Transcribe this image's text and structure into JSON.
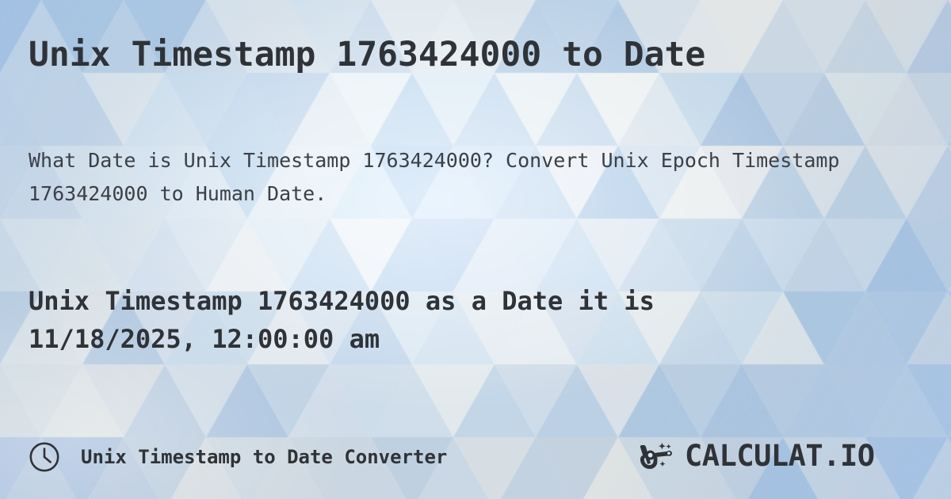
{
  "page": {
    "title": "Unix Timestamp 1763424000 to Date",
    "description": "What Date is Unix Timestamp 1763424000? Convert Unix Epoch Timestamp 1763424000 to Human Date.",
    "result": "Unix Timestamp 1763424000 as a Date it is 11/18/2025, 12:00:00 am",
    "timestamp": "1763424000",
    "converted_date": "11/18/2025, 12:00:00 am"
  },
  "footer": {
    "label": "Unix Timestamp to Date Converter",
    "clock_icon": "clock-icon",
    "logo_text": "CALCULAT.IO",
    "logo_mark": "magic-wand-hand-icon"
  },
  "colors": {
    "text_primary": "#2f3337",
    "text_secondary": "#3b4046",
    "background_light": "#e8f4ff",
    "background_mid": "#bcdcf8",
    "background_dark": "#9ac6f2",
    "accent": "#2f3337"
  }
}
